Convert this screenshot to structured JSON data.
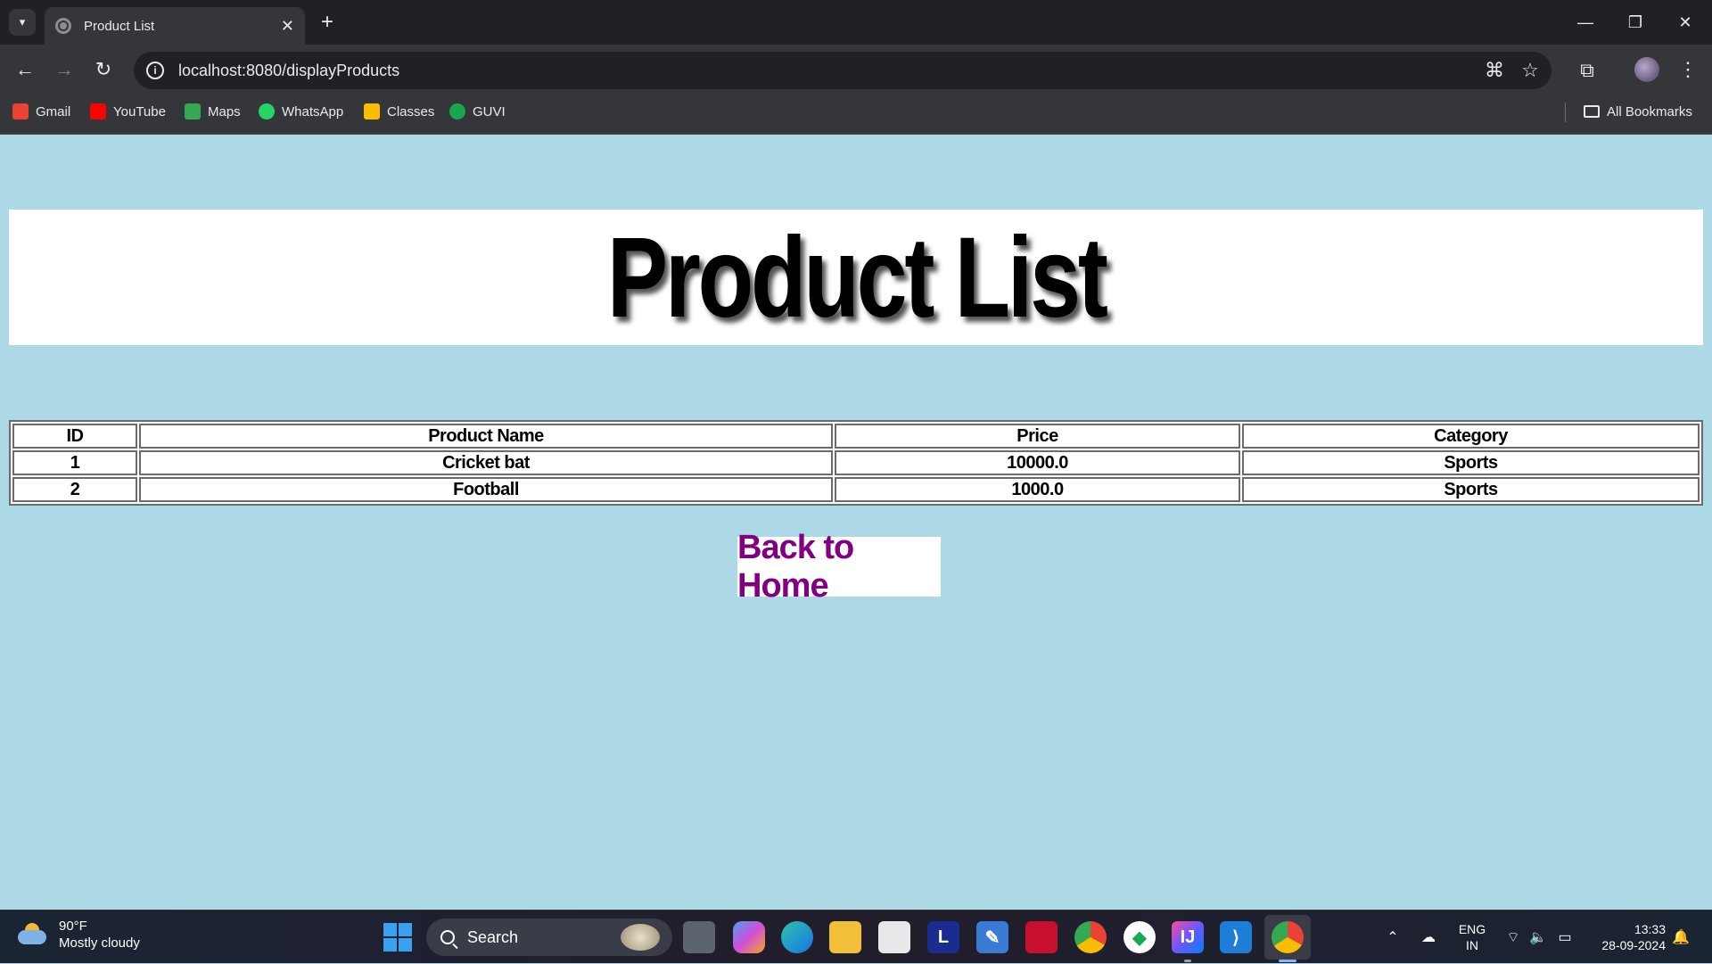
{
  "browser": {
    "tab_title": "Product List",
    "url": "localhost:8080/displayProducts",
    "bookmarks": [
      {
        "label": "Gmail",
        "color": "#ea4335"
      },
      {
        "label": "YouTube",
        "color": "#ff0000"
      },
      {
        "label": "Maps",
        "color": "#34a853"
      },
      {
        "label": "WhatsApp",
        "color": "#25d366"
      },
      {
        "label": "Classes",
        "color": "#fbbc04"
      },
      {
        "label": "GUVI",
        "color": "#1aa551"
      }
    ],
    "all_bookmarks_label": "All Bookmarks"
  },
  "page": {
    "heading": "Product List",
    "background_color": "#add8e6",
    "table": {
      "headers": [
        "ID",
        "Product Name",
        "Price",
        "Category"
      ],
      "rows": [
        [
          "1",
          "Cricket bat",
          "10000.0",
          "Sports"
        ],
        [
          "2",
          "Football",
          "1000.0",
          "Sports"
        ]
      ]
    },
    "back_link": "Back to Home",
    "back_link_color": "#800080"
  },
  "taskbar": {
    "weather_temp": "90°F",
    "weather_desc": "Mostly cloudy",
    "search_placeholder": "Search",
    "lang_line1": "ENG",
    "lang_line2": "IN",
    "time": "13:33",
    "date": "28-09-2024"
  }
}
